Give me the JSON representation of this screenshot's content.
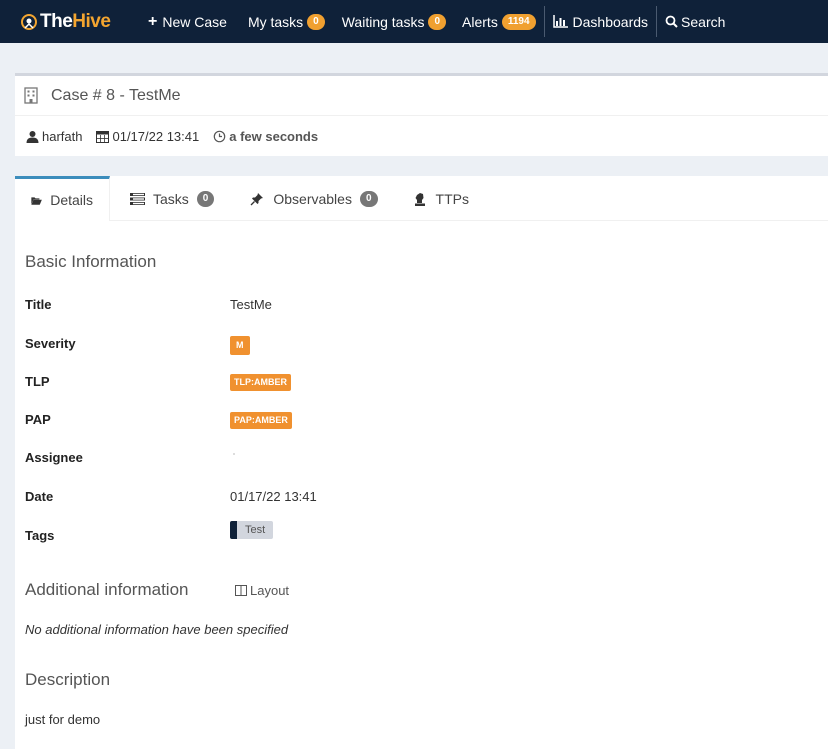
{
  "navbar": {
    "brand_a": "The",
    "brand_b": "Hive",
    "new_case": "New Case",
    "my_tasks": "My tasks",
    "my_tasks_count": "0",
    "waiting_tasks": "Waiting tasks",
    "waiting_tasks_count": "0",
    "alerts": "Alerts",
    "alerts_count": "1194",
    "dashboards": "Dashboards",
    "search": "Search"
  },
  "case": {
    "title": "Case # 8 - TestMe",
    "author": "harfath",
    "date": "01/17/22 13:41",
    "age": "a few seconds"
  },
  "tabs": {
    "details": "Details",
    "tasks": "Tasks",
    "tasks_count": "0",
    "observables": "Observables",
    "observables_count": "0",
    "ttps": "TTPs"
  },
  "basic": {
    "heading": "Basic Information",
    "title_label": "Title",
    "title_value": "TestMe",
    "severity_label": "Severity",
    "severity_value": "M",
    "tlp_label": "TLP",
    "tlp_value": "TLP:AMBER",
    "pap_label": "PAP",
    "pap_value": "PAP:AMBER",
    "assignee_label": "Assignee",
    "date_label": "Date",
    "date_value": "01/17/22 13:41",
    "tags_label": "Tags",
    "tag_value": "Test"
  },
  "additional": {
    "heading": "Additional information",
    "layout_label": "Layout",
    "empty_note": "No additional information have been specified"
  },
  "description": {
    "heading": "Description",
    "text": "just for demo"
  },
  "colors": {
    "navbar_bg": "#0f2139",
    "accent_orange": "#f0912f",
    "badge_grey": "#777777"
  }
}
